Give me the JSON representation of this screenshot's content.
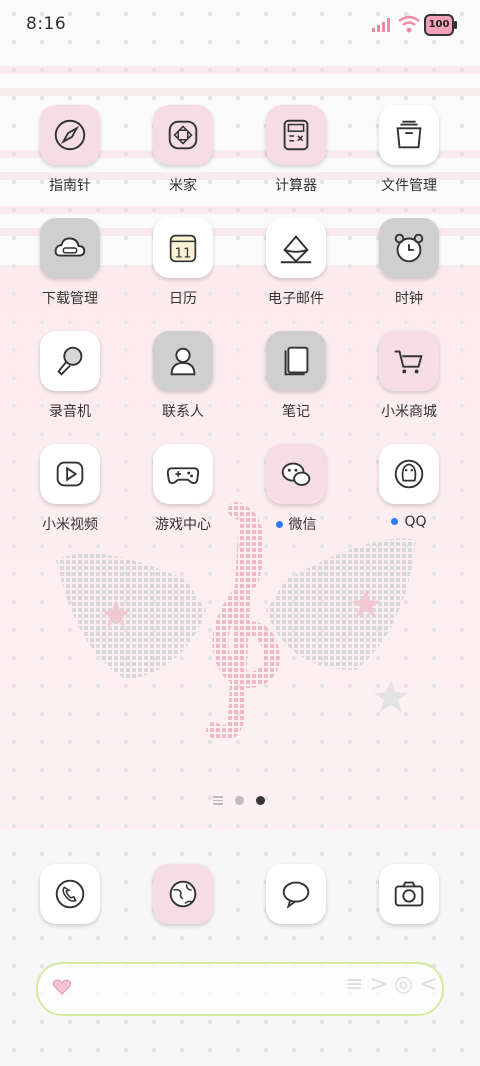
{
  "status_bar": {
    "time": "8:16",
    "battery": "100"
  },
  "rows": [
    [
      {
        "label": "指南针",
        "icon": "compass-icon"
      },
      {
        "label": "米家",
        "icon": "mijia-icon"
      },
      {
        "label": "计算器",
        "icon": "calculator-icon"
      },
      {
        "label": "文件管理",
        "icon": "file-manager-icon"
      }
    ],
    [
      {
        "label": "下载管理",
        "icon": "download-cloud-icon"
      },
      {
        "label": "日历",
        "icon": "calendar-icon"
      },
      {
        "label": "电子邮件",
        "icon": "email-icon"
      },
      {
        "label": "时钟",
        "icon": "alarm-clock-icon"
      }
    ],
    [
      {
        "label": "录音机",
        "icon": "microphone-icon"
      },
      {
        "label": "联系人",
        "icon": "contacts-icon"
      },
      {
        "label": "笔记",
        "icon": "notes-icon"
      },
      {
        "label": "小米商城",
        "icon": "shopping-cart-icon"
      }
    ],
    [
      {
        "label": "小米视频",
        "icon": "video-play-icon"
      },
      {
        "label": "游戏中心",
        "icon": "gamepad-icon"
      },
      {
        "label": "微信",
        "icon": "wechat-icon"
      },
      {
        "label": "QQ",
        "icon": "qq-penguin-icon"
      }
    ]
  ],
  "calendar_day": "11",
  "dock": [
    {
      "icon": "phone-icon"
    },
    {
      "icon": "browser-globe-icon"
    },
    {
      "icon": "messages-icon"
    },
    {
      "icon": "camera-icon"
    }
  ],
  "colors": {
    "pink_tile": "#f6dde5",
    "gray_tile": "#cfcfcf",
    "search_border": "#d6e9a3",
    "notify_dot": "#2f7cf0"
  }
}
